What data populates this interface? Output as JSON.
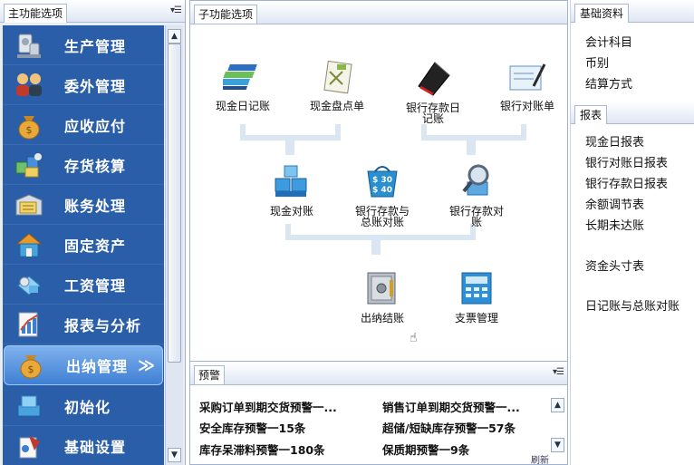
{
  "left": {
    "title": "主功能选项",
    "menu_glyph": "▾☰",
    "items": [
      {
        "label": "生产管理",
        "icon": "production-icon"
      },
      {
        "label": "委外管理",
        "icon": "outsourcing-icon"
      },
      {
        "label": "应收应付",
        "icon": "money-bag-icon"
      },
      {
        "label": "存货核算",
        "icon": "inventory-icon"
      },
      {
        "label": "账务处理",
        "icon": "accounting-icon"
      },
      {
        "label": "固定资产",
        "icon": "house-icon"
      },
      {
        "label": "工资管理",
        "icon": "salary-icon"
      },
      {
        "label": "报表与分析",
        "icon": "report-chart-icon"
      },
      {
        "label": "出纳管理",
        "icon": "cashier-icon",
        "arrow": "≫"
      },
      {
        "label": "初始化",
        "icon": "initialize-icon"
      },
      {
        "label": "基础设置",
        "icon": "settings-icon"
      }
    ],
    "active_index": 8
  },
  "center": {
    "title": "子功能选项",
    "functions": {
      "cash_journal": "现金日记账",
      "cash_count": "现金盘点单",
      "bank_journal": "银行存款日记账",
      "bank_statement": "银行对账单",
      "cash_reconcile": "现金对账",
      "bank_gl_reconcile": "银行存款与总账对账",
      "bank_reconcile": "银行存款对账",
      "close_account": "出纳结账",
      "check_manage": "支票管理"
    }
  },
  "warnings": {
    "title": "预警",
    "menu_glyph": "▾☰",
    "items": [
      "采购订单到期交货预警一...",
      "销售订单到期交货预警一...",
      "安全库存预警一15条",
      "超储/短缺库存预警一57条",
      "库存呆滞料预警一180条",
      "保质期预警一9条"
    ],
    "refresh": "刷新"
  },
  "right": {
    "basic_title": "基础资料",
    "basic_items": [
      "会计科目",
      "币别",
      "结算方式"
    ],
    "report_title": "报表",
    "report_items": [
      "现金日报表",
      "银行对账日报表",
      "银行存款日报表",
      "余额调节表",
      "长期未达账",
      "资金头寸表",
      "日记账与总账对账"
    ]
  },
  "colors": {
    "nav_bg": "#2b5ea8",
    "nav_active": "#5a98e2",
    "flow_line": "#dbe6f3"
  }
}
